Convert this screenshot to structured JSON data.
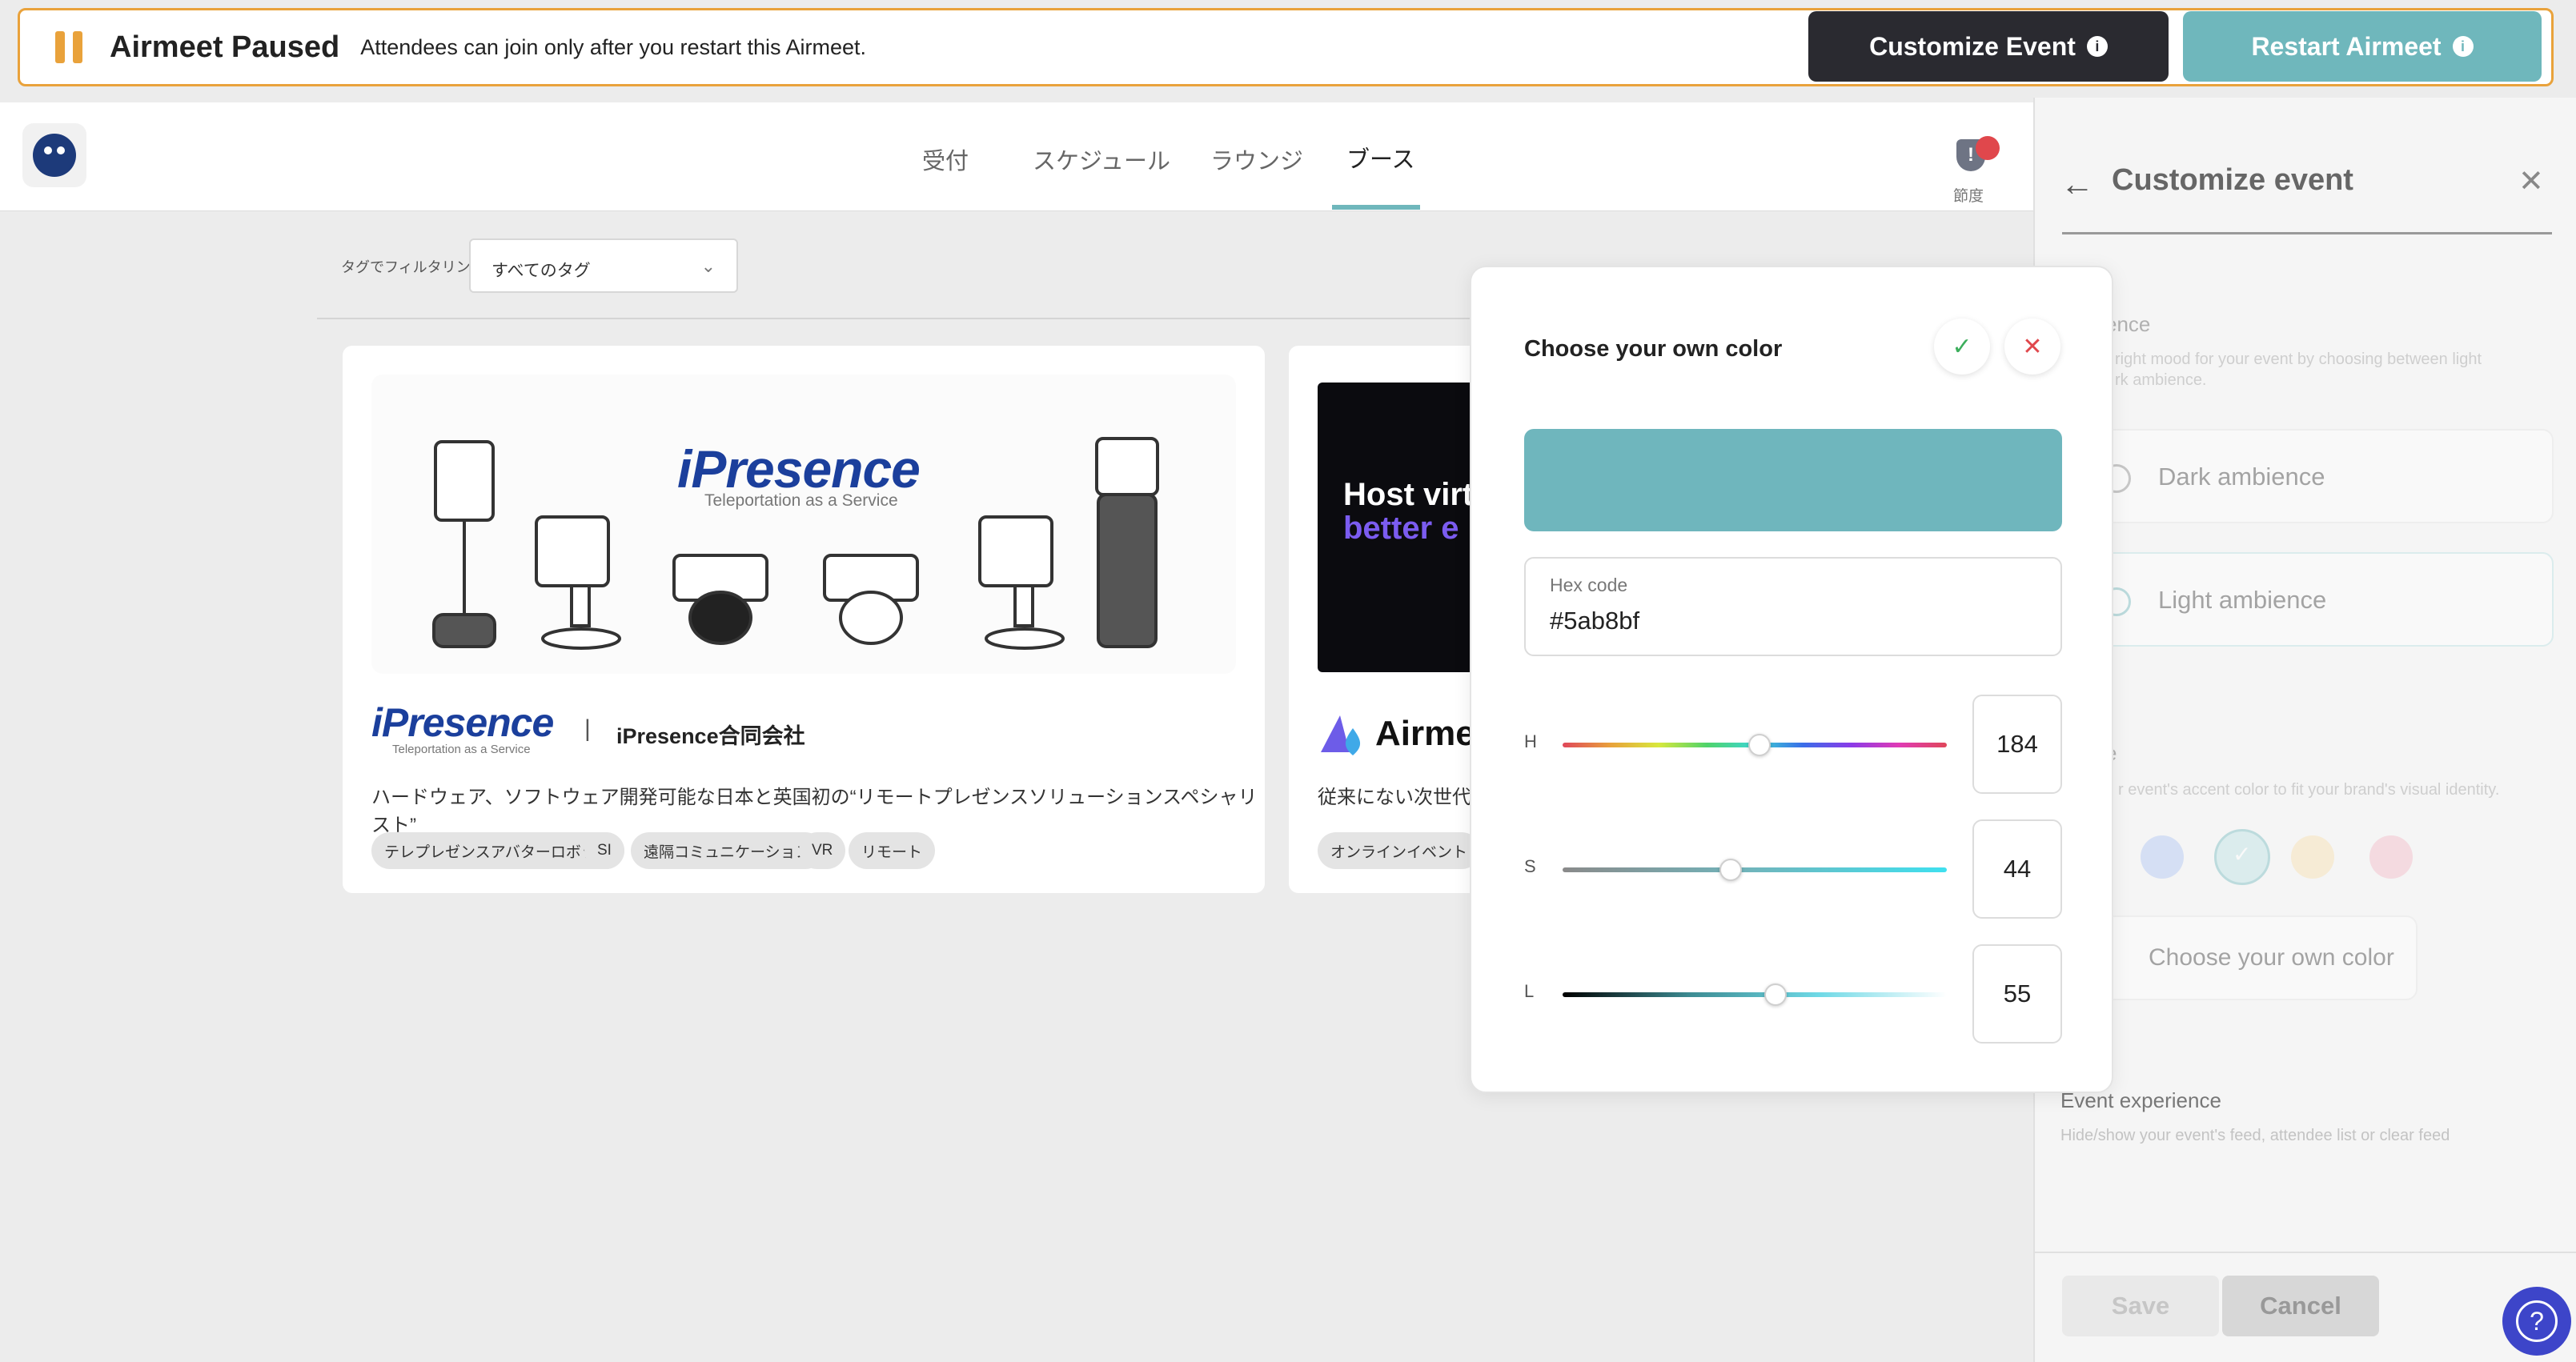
{
  "banner": {
    "title": "Airmeet Paused",
    "description": "Attendees can join only after you restart this Airmeet.",
    "customize_label": "Customize Event",
    "restart_label": "Restart Airmeet"
  },
  "nav": {
    "tabs": [
      {
        "label": "受付"
      },
      {
        "label": "スケジュール"
      },
      {
        "label": "ラウンジ"
      },
      {
        "label": "ブース",
        "active": true
      }
    ],
    "shield_label": "節度"
  },
  "filter": {
    "label": "タグでフィルタリング",
    "selected": "すべてのタグ"
  },
  "booths": [
    {
      "logo": "iPresence",
      "logo_sub": "Teleportation as a Service",
      "separator": "|",
      "company": "iPresence合同会社",
      "description": "ハードウェア、ソフトウェア開発可能な日本と英国初の“リモートプレゼンスソリューションスペシャリスト”",
      "tags": [
        "テレプレゼンスアバターロボット",
        "SI",
        "遠隔コミュニケーション",
        "VR",
        "リモート"
      ]
    },
    {
      "banner_line1": "Host virt",
      "banner_line2": "better e",
      "logo": "Airme",
      "description": "従来にない次世代",
      "tags": [
        "オンラインイベント"
      ]
    }
  ],
  "color_picker": {
    "title": "Choose your own color",
    "hex_label": "Hex code",
    "hex_value": "#5ab8bf",
    "preview_color": "#6fb6bd",
    "h_label": "H",
    "h_value": "184",
    "s_label": "S",
    "s_value": "44",
    "l_label": "L",
    "l_value": "55",
    "confirm_icon": "check-icon",
    "close_icon": "close-icon"
  },
  "panel": {
    "title": "Customize event",
    "ambience_title": "ence",
    "ambience_desc_1": "right mood for your event by choosing between light",
    "ambience_desc_2": "rk ambience.",
    "dark_label": "Dark ambience",
    "light_label": "Light ambience",
    "accent_title": "e",
    "accent_desc": "r event's accent color to fit your brand's visual identity.",
    "swatches": [
      "#a9c1f3",
      "#b7e0e3",
      "#f8dda9",
      "#f3b6c3"
    ],
    "own_color_label": "Choose your own color",
    "experience_title": "Event experience",
    "experience_desc": "Hide/show your event's feed, attendee list or clear feed",
    "save_label": "Save",
    "cancel_label": "Cancel"
  },
  "colors": {
    "accent": "#6fb7bc",
    "warning": "#e9a23b",
    "dark_button": "#2a2a30",
    "help": "#3d45c9"
  }
}
